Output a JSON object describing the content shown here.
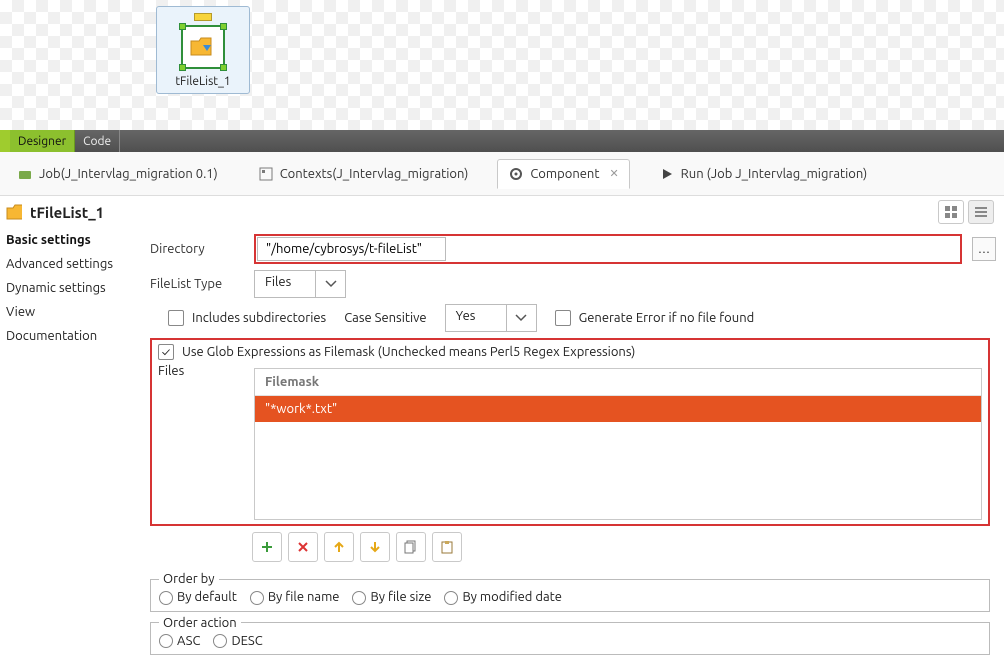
{
  "canvas": {
    "node_label": "tFileList_1"
  },
  "modebar": {
    "designer": "Designer",
    "code": "Code"
  },
  "tabs": {
    "job": "Job(J_Intervlag_migration 0.1)",
    "contexts": "Contexts(J_Intervlag_migration)",
    "component": "Component",
    "run": "Run (Job J_Intervlag_migration)"
  },
  "header": {
    "title": "tFileList_1"
  },
  "sidebar": {
    "items": [
      "Basic settings",
      "Advanced settings",
      "Dynamic settings",
      "View",
      "Documentation"
    ]
  },
  "form": {
    "directory_label": "Directory",
    "directory_value": "\"/home/cybrosys/t-fileList\"",
    "filelist_type_label": "FileList Type",
    "filelist_type_value": "Files",
    "includes_subdirs": "Includes subdirectories",
    "case_sensitive_label": "Case Sensitive",
    "case_sensitive_value": "Yes",
    "generate_error": "Generate Error if no file found",
    "use_glob": "Use Glob Expressions as Filemask (Unchecked means Perl5 Regex Expressions)",
    "files_label": "Files",
    "filemask_header": "Filemask",
    "filemask_rows": [
      "\"*work*.txt\""
    ],
    "order_by_label": "Order by",
    "order_by_options": [
      "By default",
      "By file name",
      "By file size",
      "By modified date"
    ],
    "order_action_label": "Order action",
    "order_action_options": [
      "ASC",
      "DESC"
    ]
  }
}
